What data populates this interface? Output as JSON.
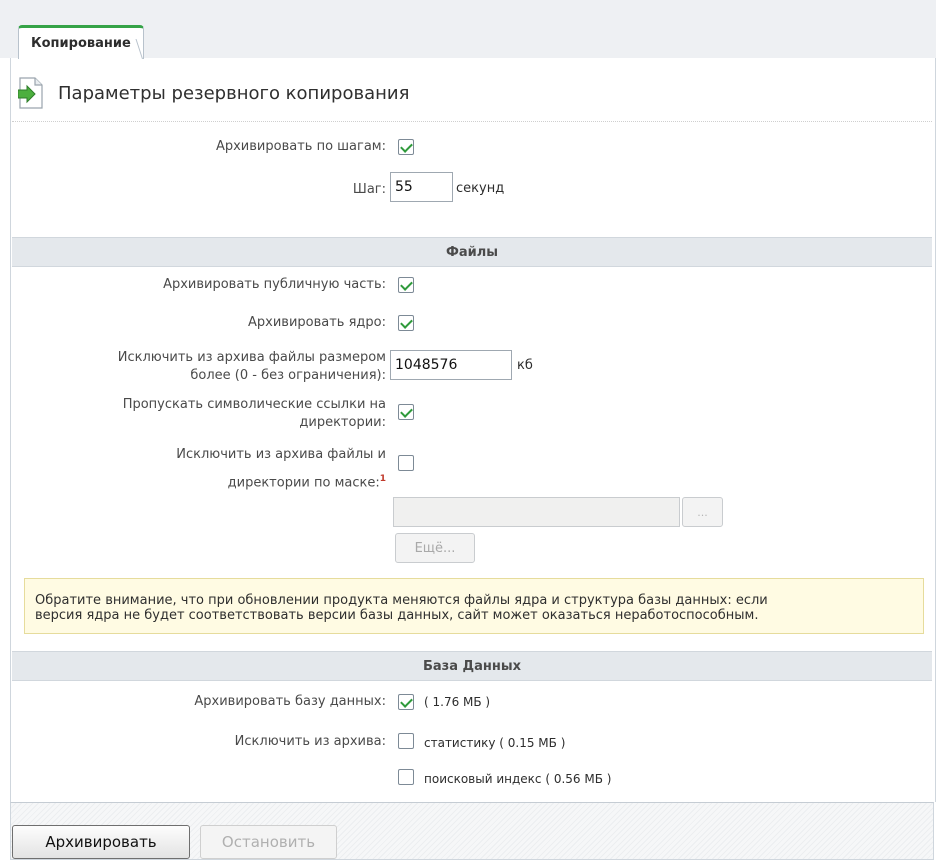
{
  "tab": {
    "label": "Копирование"
  },
  "page_title": "Параметры резервного копирования",
  "general": {
    "archive_by_steps_label": "Архивировать по шагам:",
    "archive_by_steps_checked": true,
    "step_label": "Шаг:",
    "step_value": "55",
    "step_unit": "секунд"
  },
  "files": {
    "section_title": "Файлы",
    "public_label": "Архивировать публичную часть:",
    "public_checked": true,
    "core_label": "Архивировать ядро:",
    "core_checked": true,
    "max_size_label_line1": "Исключить из архива файлы размером",
    "max_size_label_line2": "более (0 - без ограничения):",
    "max_size_value": "1048576",
    "max_size_unit": "кб",
    "skip_symlinks_label_line1": "Пропускать символические ссылки на",
    "skip_symlinks_label_line2": "директории:",
    "skip_symlinks_checked": true,
    "exclude_mask_label_line1": "Исключить из архива файлы и",
    "exclude_mask_label_line2": "директории по маске:",
    "exclude_mask_footnote": "1",
    "exclude_mask_checked": false,
    "mask_value": "",
    "browse_button": "...",
    "more_button": "Ещё..."
  },
  "notice": {
    "line1": "Обратите внимание, что при обновлении продукта меняются файлы ядра и структура базы данных: если",
    "line2": "версия ядра не будет соответствовать версии базы данных, сайт может оказаться неработоспособным."
  },
  "database": {
    "section_title": "База Данных",
    "archive_db_label": "Архивировать базу данных:",
    "archive_db_checked": true,
    "archive_db_size": "( 1.76 МБ )",
    "exclude_label": "Исключить из архива:",
    "stats_checked": false,
    "stats_label": "статистику ( 0.15 МБ )",
    "search_index_checked": false,
    "search_index_label": "поисковый индекс ( 0.56 МБ )"
  },
  "buttons": {
    "archive": "Архивировать",
    "stop": "Остановить"
  },
  "colors": {
    "accent_green": "#35a347",
    "section_bg": "#e4e8ec",
    "notice_bg": "#fffbe3"
  }
}
